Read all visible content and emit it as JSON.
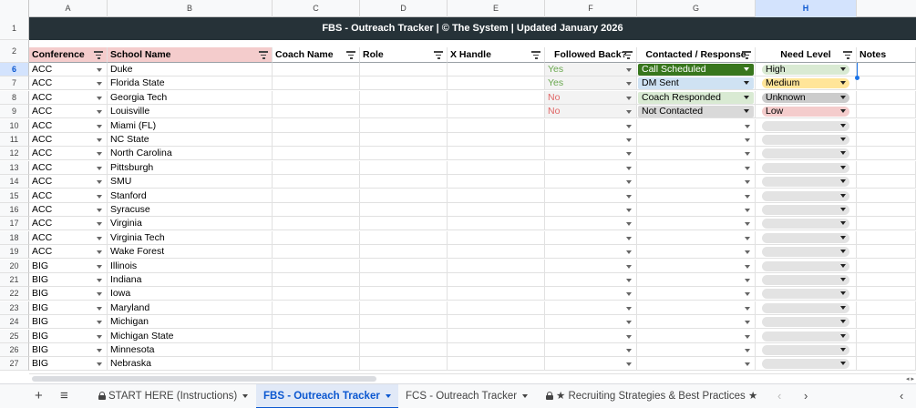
{
  "columns": [
    "A",
    "B",
    "C",
    "D",
    "E",
    "F",
    "G",
    "H"
  ],
  "active_column": "H",
  "banner": "FBS - Outreach Tracker | © The System | Updated January 2026",
  "headers": {
    "conference": "Conference",
    "school": "School Name",
    "coach": "Coach Name",
    "role": "Role",
    "x_handle": "X Handle",
    "followed_back": "Followed Back?",
    "contacted": "Contacted / Response",
    "need": "Need Level",
    "notes": "Notes"
  },
  "row_numbers": {
    "r1": "1",
    "r2": "2"
  },
  "active_row": "6",
  "rows": [
    {
      "num": "6",
      "conference": "ACC",
      "school": "Duke",
      "followed": "Yes",
      "contacted": "Call Scheduled",
      "need": "High"
    },
    {
      "num": "7",
      "conference": "ACC",
      "school": "Florida State",
      "followed": "Yes",
      "contacted": "DM Sent",
      "need": "Medium"
    },
    {
      "num": "8",
      "conference": "ACC",
      "school": "Georgia Tech",
      "followed": "No",
      "contacted": "Coach Responded",
      "need": "Unknown"
    },
    {
      "num": "9",
      "conference": "ACC",
      "school": "Louisville",
      "followed": "No",
      "contacted": "Not Contacted",
      "need": "Low"
    },
    {
      "num": "10",
      "conference": "ACC",
      "school": "Miami (FL)",
      "followed": "",
      "contacted": "",
      "need": ""
    },
    {
      "num": "11",
      "conference": "ACC",
      "school": "NC State",
      "followed": "",
      "contacted": "",
      "need": ""
    },
    {
      "num": "12",
      "conference": "ACC",
      "school": "North Carolina",
      "followed": "",
      "contacted": "",
      "need": ""
    },
    {
      "num": "13",
      "conference": "ACC",
      "school": "Pittsburgh",
      "followed": "",
      "contacted": "",
      "need": ""
    },
    {
      "num": "14",
      "conference": "ACC",
      "school": "SMU",
      "followed": "",
      "contacted": "",
      "need": ""
    },
    {
      "num": "15",
      "conference": "ACC",
      "school": "Stanford",
      "followed": "",
      "contacted": "",
      "need": ""
    },
    {
      "num": "16",
      "conference": "ACC",
      "school": "Syracuse",
      "followed": "",
      "contacted": "",
      "need": ""
    },
    {
      "num": "17",
      "conference": "ACC",
      "school": "Virginia",
      "followed": "",
      "contacted": "",
      "need": ""
    },
    {
      "num": "18",
      "conference": "ACC",
      "school": "Virginia Tech",
      "followed": "",
      "contacted": "",
      "need": ""
    },
    {
      "num": "19",
      "conference": "ACC",
      "school": "Wake Forest",
      "followed": "",
      "contacted": "",
      "need": ""
    },
    {
      "num": "20",
      "conference": "BIG",
      "school": "Illinois",
      "followed": "",
      "contacted": "",
      "need": ""
    },
    {
      "num": "21",
      "conference": "BIG",
      "school": "Indiana",
      "followed": "",
      "contacted": "",
      "need": ""
    },
    {
      "num": "22",
      "conference": "BIG",
      "school": "Iowa",
      "followed": "",
      "contacted": "",
      "need": ""
    },
    {
      "num": "23",
      "conference": "BIG",
      "school": "Maryland",
      "followed": "",
      "contacted": "",
      "need": ""
    },
    {
      "num": "24",
      "conference": "BIG",
      "school": "Michigan",
      "followed": "",
      "contacted": "",
      "need": ""
    },
    {
      "num": "25",
      "conference": "BIG",
      "school": "Michigan State",
      "followed": "",
      "contacted": "",
      "need": ""
    },
    {
      "num": "26",
      "conference": "BIG",
      "school": "Minnesota",
      "followed": "",
      "contacted": "",
      "need": ""
    },
    {
      "num": "27",
      "conference": "BIG",
      "school": "Nebraska",
      "followed": "",
      "contacted": "",
      "need": ""
    }
  ],
  "status_colors": {
    "Yes": "#6aa84f",
    "No": "#e06666",
    "Call Scheduled": "#38761d",
    "DM Sent": "#cfe2f3",
    "Coach Responded": "#d9ead3",
    "Not Contacted": "#d9d9d9",
    "High": "#d9ead3",
    "Medium": "#ffe599",
    "Unknown": "#cccccc",
    "Low": "#f4cccc"
  },
  "tabs": {
    "add": "+",
    "menu": "≡",
    "start_here": "START HERE (Instructions)",
    "fbs": "FBS - Outreach Tracker",
    "fcs": "FCS - Outreach Tracker",
    "strategies": "★ Recruiting Strategies & Best Practices ★",
    "prev": "‹",
    "next": "›",
    "collapse": "‹"
  }
}
